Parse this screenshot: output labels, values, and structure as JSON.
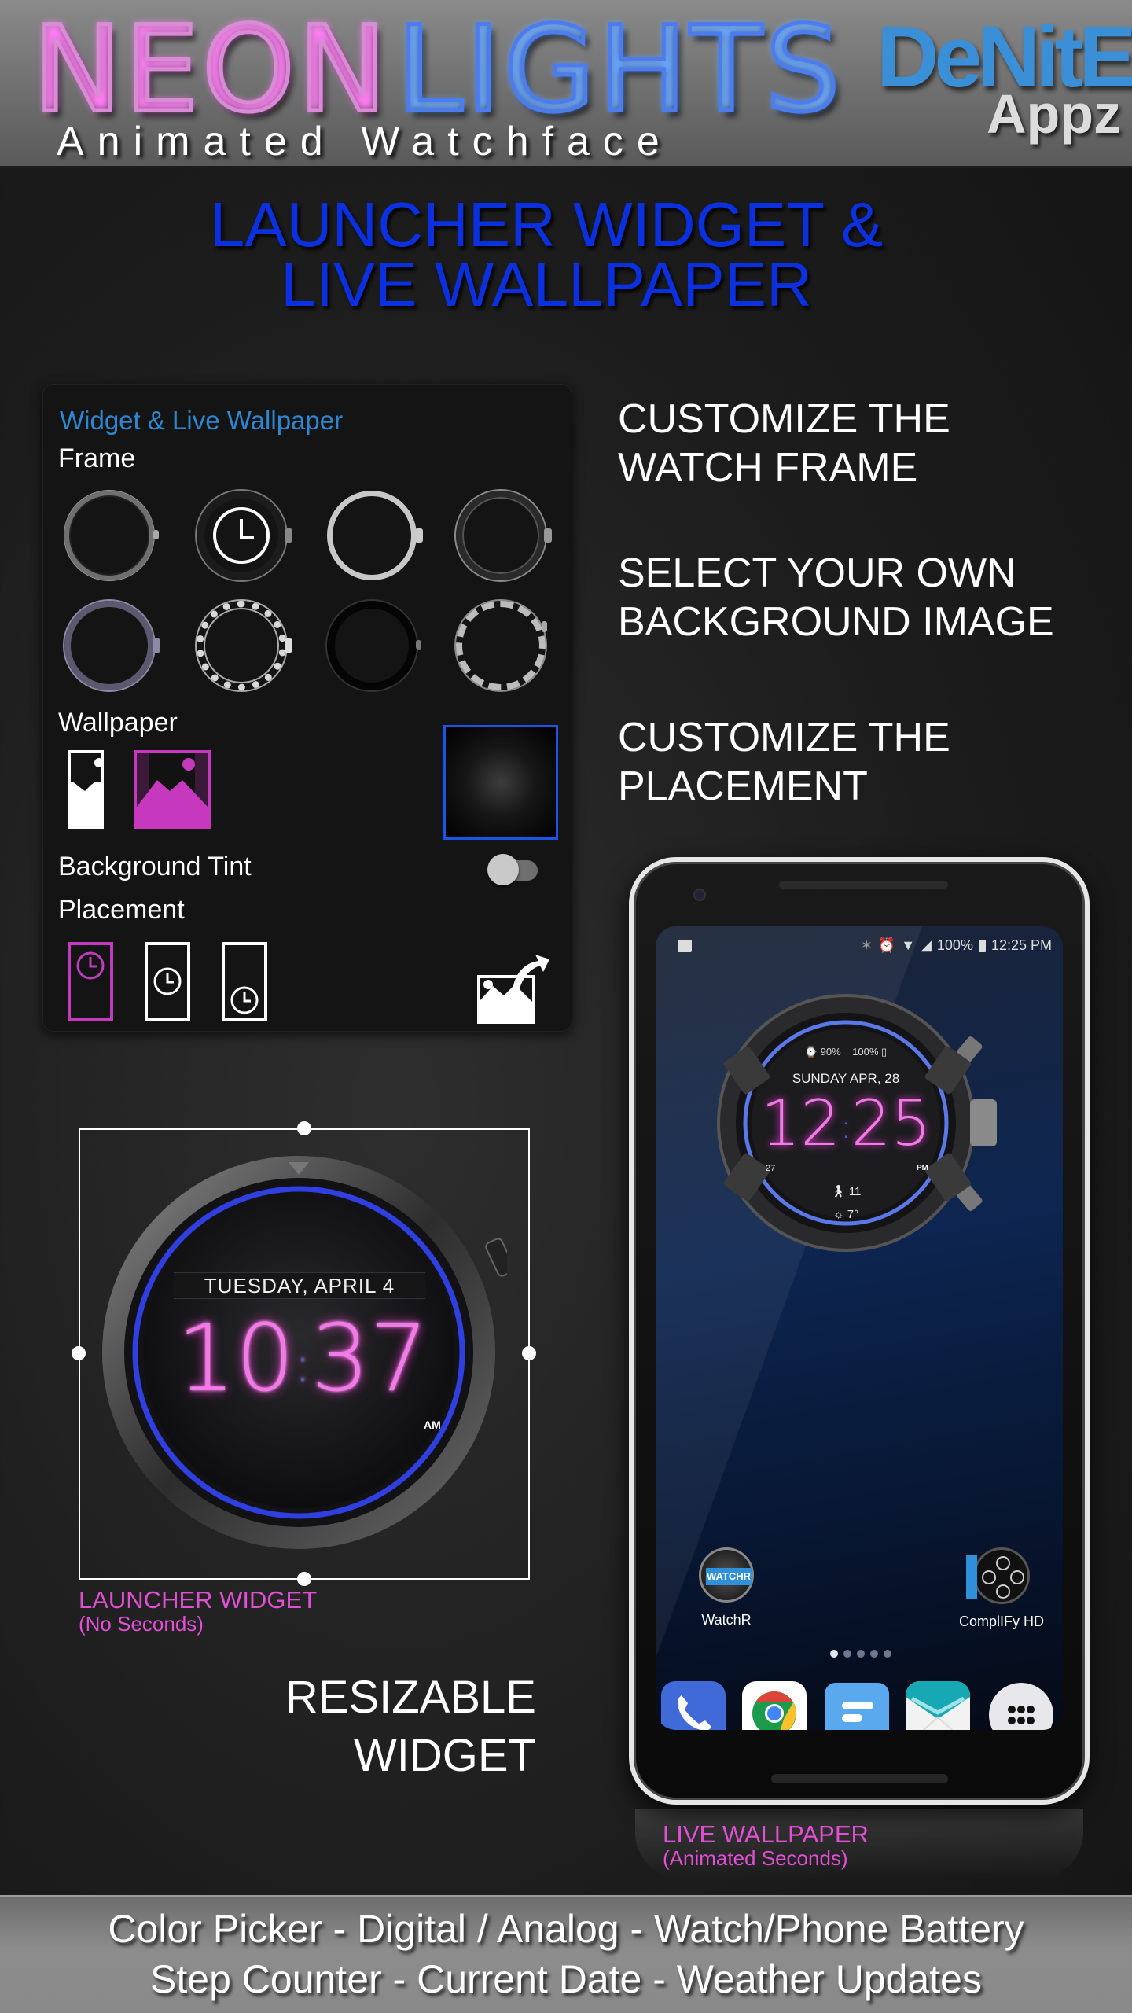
{
  "header": {
    "title_word_1": "NEON",
    "title_word_2": "LIGHTS",
    "subtitle": "Animated Watchface",
    "brand_main": "DeNitE!",
    "brand_sub": "Appz",
    "colors": {
      "neon_pink": "#d98bd6",
      "neon_blue": "#4c7df0",
      "brand_blue": "#3a8fd6"
    }
  },
  "headline": {
    "line1": "LAUNCHER WIDGET &",
    "line2": "LIVE WALLPAPER",
    "color": "#0a30e0"
  },
  "settings": {
    "title": "Widget & Live Wallpaper",
    "frame_label": "Frame",
    "frames": [
      {
        "name": "frame-steel-bezel",
        "selected": false
      },
      {
        "name": "frame-dark-neon",
        "selected": true
      },
      {
        "name": "frame-silver-classic",
        "selected": false
      },
      {
        "name": "frame-black-chrome",
        "selected": false
      },
      {
        "name": "frame-purple-titanium",
        "selected": false
      },
      {
        "name": "frame-diamond-bezel",
        "selected": false
      },
      {
        "name": "frame-matte-black",
        "selected": false
      },
      {
        "name": "frame-knurled-silver",
        "selected": false
      }
    ],
    "wallpaper_label": "Wallpaper",
    "wallpaper_options": [
      {
        "name": "wallpaper-portrait",
        "selected": false
      },
      {
        "name": "wallpaper-landscape",
        "selected": true
      }
    ],
    "background_tint_label": "Background Tint",
    "background_tint_on": false,
    "placement_label": "Placement",
    "placement_options": [
      {
        "name": "top",
        "selected": true
      },
      {
        "name": "middle",
        "selected": false
      },
      {
        "name": "bottom",
        "selected": false
      }
    ],
    "accent_color": "#c03bbd",
    "preview_border_color": "#1756e6"
  },
  "features": [
    {
      "line1": "CUSTOMIZE THE",
      "line2": "WATCH FRAME"
    },
    {
      "line1": "SELECT YOUR OWN",
      "line2": "BACKGROUND IMAGE"
    },
    {
      "line1": "CUSTOMIZE THE",
      "line2": "PLACEMENT"
    }
  ],
  "widget": {
    "date": "TUESDAY, APRIL 4",
    "hours": "10",
    "minutes": "37",
    "ampm": "AM",
    "caption_main": "LAUNCHER WIDGET",
    "caption_sub": "(No Seconds)",
    "resizable_line1": "RESIZABLE",
    "resizable_line2": "WIDGET"
  },
  "phone": {
    "status": {
      "battery": "100%",
      "time": "12:25 PM"
    },
    "watch": {
      "watch_battery": "90%",
      "phone_battery": "100%",
      "date": "SUNDAY APR, 28",
      "hours": "12",
      "minutes": "25",
      "seconds": "27",
      "ampm": "PM",
      "steps": "11",
      "temperature": "7°"
    },
    "apps": [
      {
        "label": "WatchR",
        "icon": "watchr-icon"
      },
      {
        "label": "ComplIFy HD",
        "icon": "complify-icon"
      }
    ],
    "page_count": 5,
    "active_page": 1,
    "dock": [
      "phone-icon",
      "chrome-icon",
      "messages-icon",
      "email-icon",
      "app-drawer-icon"
    ],
    "caption_main": "LIVE WALLPAPER",
    "caption_sub": "(Animated Seconds)"
  },
  "footer": {
    "line1": "Color Picker - Digital / Analog - Watch/Phone Battery",
    "line2": "Step Counter - Current Date - Weather Updates"
  }
}
